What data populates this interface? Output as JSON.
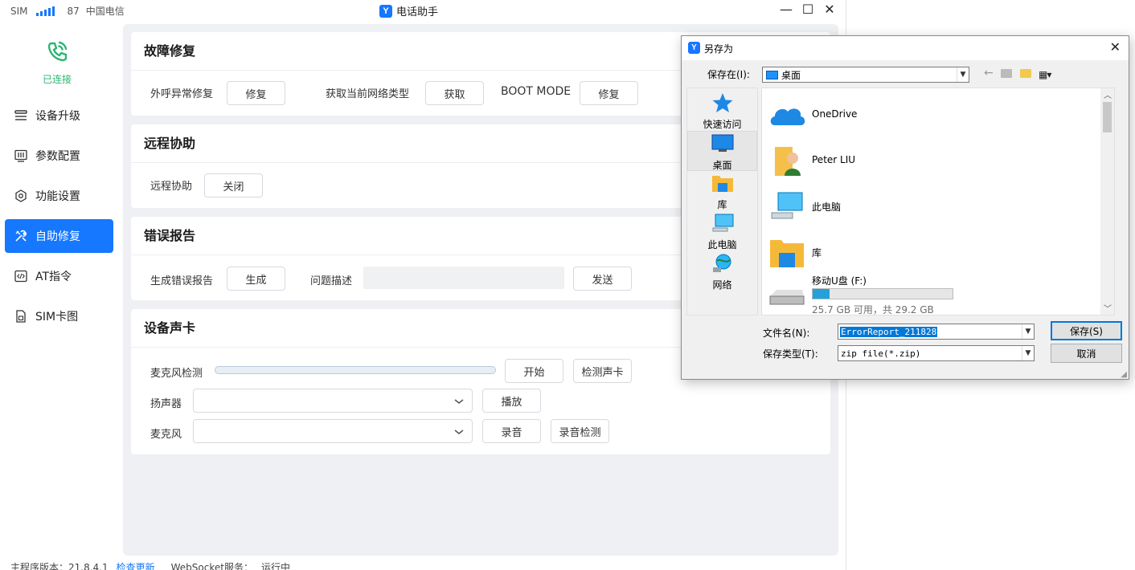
{
  "status": {
    "sim": "SIM",
    "signal": "87",
    "carrier": "中国电信"
  },
  "window": {
    "title": "电话助手",
    "minimize": "—",
    "maximize": "☐",
    "close": "✕"
  },
  "connection": {
    "label": "已连接",
    "color": "#2bb673"
  },
  "sidebar": {
    "items": [
      {
        "label": "设备升级",
        "icon": "list-icon"
      },
      {
        "label": "参数配置",
        "icon": "sliders-icon"
      },
      {
        "label": "功能设置",
        "icon": "gear-icon"
      },
      {
        "label": "自助修复",
        "icon": "tools-icon",
        "active": true
      },
      {
        "label": "AT指令",
        "icon": "code-icon"
      },
      {
        "label": "SIM卡图",
        "icon": "sim-icon"
      }
    ]
  },
  "repair": {
    "title": "故障修复",
    "outgoing_label": "外呼异常修复",
    "outgoing_btn": "修复",
    "network_label": "获取当前网络类型",
    "network_btn": "获取",
    "boot_label": "BOOT MODE",
    "boot_btn": "修复"
  },
  "remote": {
    "title": "远程协助",
    "label": "远程协助",
    "btn": "关闭"
  },
  "error_report": {
    "title": "错误报告",
    "gen_label": "生成错误报告",
    "gen_btn": "生成",
    "desc_label": "问题描述",
    "desc_value": "",
    "send_btn": "发送"
  },
  "sound": {
    "title": "设备声卡",
    "mic_test_label": "麦克风检测",
    "mic_level": 0,
    "start_btn": "开始",
    "detect_btn": "检测声卡",
    "speaker_label": "扬声器",
    "speaker_value": "",
    "play_btn": "播放",
    "mic_label": "麦克风",
    "mic_value": "",
    "record_btn": "录音",
    "record_test_btn": "录音检测"
  },
  "footer": {
    "version": "主程序版本：21.8.4.1",
    "check_update": "检查更新",
    "ws_label": "WebSocket服务：",
    "ws_status": "运行中"
  },
  "dialog": {
    "title": "另存为",
    "save_in_label": "保存在(I):",
    "save_in_value": "桌面",
    "places": [
      {
        "label": "快速访问",
        "icon": "star-icon"
      },
      {
        "label": "桌面",
        "icon": "desktop-icon",
        "selected": true
      },
      {
        "label": "库",
        "icon": "library-icon"
      },
      {
        "label": "此电脑",
        "icon": "computer-icon"
      },
      {
        "label": "网络",
        "icon": "network-icon"
      }
    ],
    "files": [
      {
        "name": "OneDrive",
        "icon": "cloud-icon"
      },
      {
        "name": "Peter LIU",
        "icon": "user-folder-icon"
      },
      {
        "name": "此电脑",
        "icon": "computer-icon"
      },
      {
        "name": "库",
        "icon": "library-icon"
      },
      {
        "name": "移动U盘 (F:)",
        "icon": "drive-icon",
        "detail": "25.7 GB 可用，共 29.2 GB",
        "free_fraction": 0.12
      }
    ],
    "filename_label": "文件名(N):",
    "filename_value": "ErrorReport_211828",
    "filetype_label": "保存类型(T):",
    "filetype_value": "zip file(*.zip)",
    "save_btn": "保存(S)",
    "cancel_btn": "取消",
    "close": "✕"
  }
}
